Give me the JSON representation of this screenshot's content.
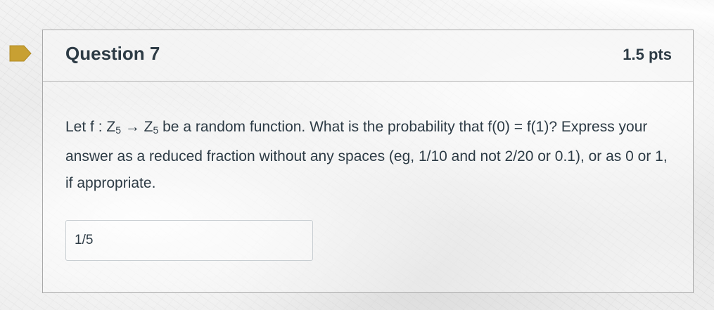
{
  "question": {
    "title": "Question 7",
    "points": "1.5 pts",
    "text": {
      "intro": "Let f : Z",
      "sub1": "5",
      "arrow": " → Z",
      "sub2": "5",
      "rest": " be a random function. What is the probability that f(0) = f(1)? Express your answer as a reduced fraction without any spaces (eg, 1/10 and not 2/20 or 0.1), or as 0 or 1, if appropriate."
    },
    "answer_value": "1/5",
    "flag_icon": "bookmark-flag-icon"
  },
  "colors": {
    "flag": "#c8a032",
    "text": "#2d3b45",
    "border": "#a8a8a8"
  }
}
